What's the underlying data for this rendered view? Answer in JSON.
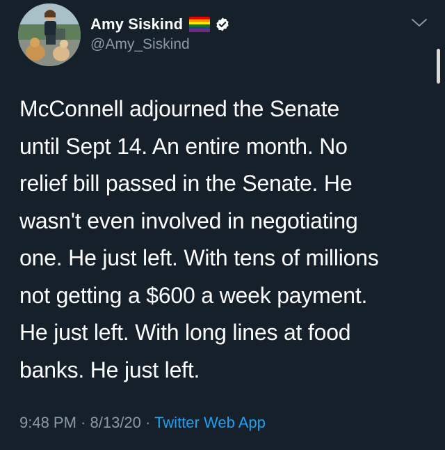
{
  "author": {
    "display_name": "Amy Siskind",
    "handle": "@Amy_Siskind",
    "badge_icons": [
      "rainbow-flag-icon",
      "verified-icon"
    ]
  },
  "tweet": {
    "lines": [
      "McConnell adjourned the Senate",
      "until Sept 14.  An entire month.  No",
      "relief bill passed in the Senate.  He",
      "wasn't even involved in negotiating",
      "one. He just left. With tens of millions",
      "not getting a $600 a week payment.",
      "He just left.  With long lines at food",
      "banks. He just left."
    ]
  },
  "meta": {
    "time": "9:48 PM",
    "separator": " · ",
    "date": "8/13/20",
    "source": "Twitter Web App"
  },
  "colors": {
    "background": "#15202b",
    "text": "#ffffff",
    "secondary": "#8899a6",
    "accent": "#1da1f2"
  },
  "icons": {
    "menu": "chevron-down-icon"
  }
}
